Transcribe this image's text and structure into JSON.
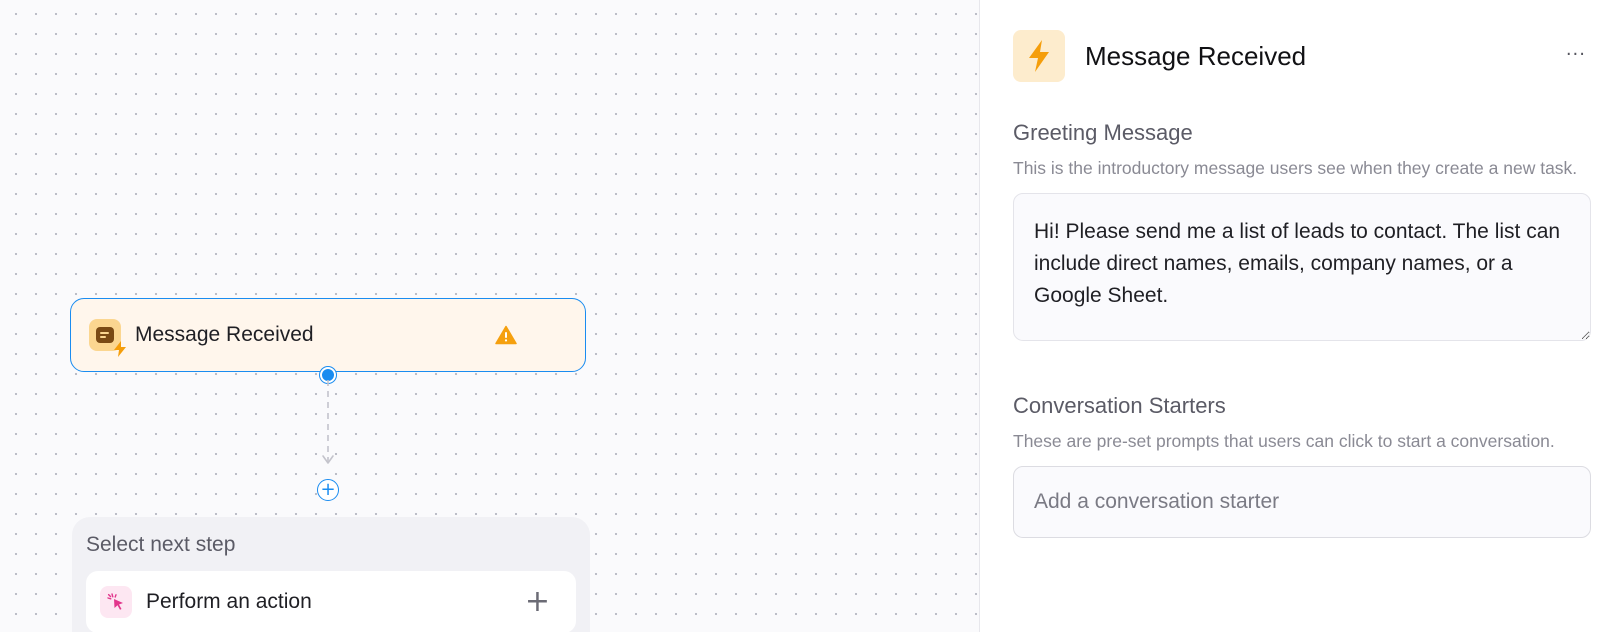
{
  "canvas": {
    "trigger_node": {
      "title": "Message Received",
      "status_icon": "warning-icon",
      "icon": "message-trigger-icon"
    },
    "add_step_icon": "plus-circle-icon",
    "next_step_panel": {
      "title": "Select next step",
      "options": [
        {
          "label": "Perform an action",
          "icon": "cursor-click-icon",
          "add_icon": "plus-icon"
        }
      ]
    }
  },
  "side_panel": {
    "title": "Message Received",
    "header_icon": "bolt-icon",
    "more_icon": "···",
    "greeting": {
      "label": "Greeting Message",
      "help": "This is the introductory message users see when they create a new task.",
      "value": "Hi! Please send me a list of leads to contact. The list can include direct names, emails, company names, or a Google Sheet."
    },
    "starters": {
      "label": "Conversation Starters",
      "help": "These are pre-set prompts that users can click to start a conversation.",
      "placeholder": "Add a conversation starter"
    }
  },
  "colors": {
    "accent": "#1a8cf0",
    "trigger_bg": "#fff6ec",
    "warning": "#f5a00f",
    "bolt": "#f59e0b",
    "action_pink": "#e2368c"
  }
}
